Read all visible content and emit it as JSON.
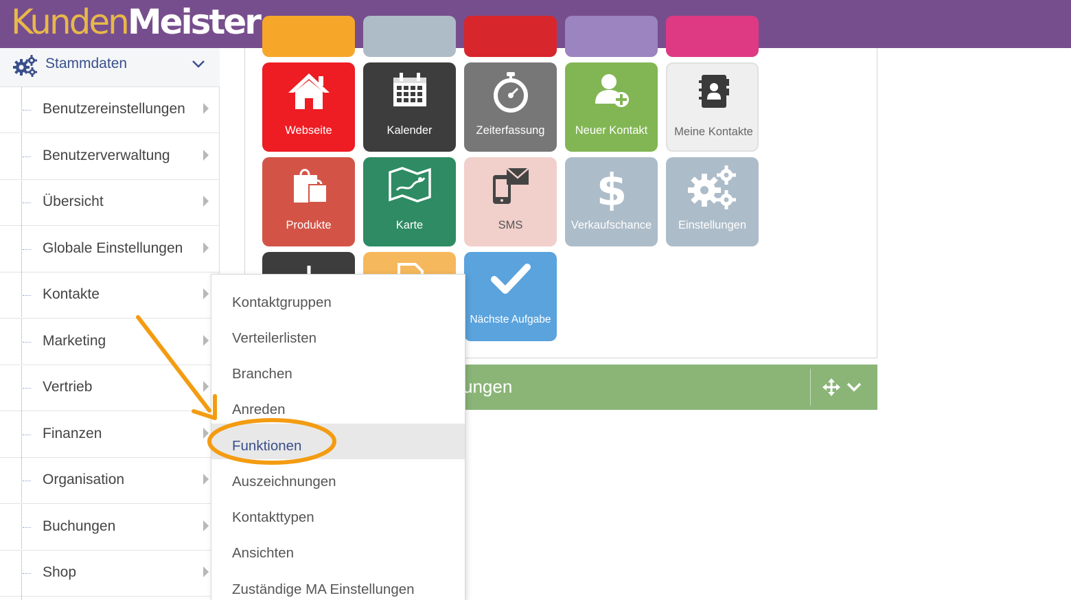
{
  "app": {
    "logo_part1": "Kunden",
    "logo_part2": "Meister",
    "colors": {
      "topbar": "#774e8d",
      "logo_gold": "#e8b84a",
      "accent_blue": "#3a4f8a",
      "highlight_orange": "#f39c12"
    }
  },
  "sidebar": {
    "header_label": "Stammdaten",
    "header_icon": "gears-icon",
    "items": [
      {
        "label": "Benutzereinstellungen"
      },
      {
        "label": "Benutzerverwaltung"
      },
      {
        "label": "Übersicht"
      },
      {
        "label": "Globale Einstellungen"
      },
      {
        "label": "Kontakte"
      },
      {
        "label": "Marketing"
      },
      {
        "label": "Vertrieb"
      },
      {
        "label": "Finanzen"
      },
      {
        "label": "Organisation"
      },
      {
        "label": "Buchungen"
      },
      {
        "label": "Shop"
      }
    ]
  },
  "tiles": [
    {
      "label": "Webseite",
      "icon": "home-icon",
      "color": "#ee1c23"
    },
    {
      "label": "Kalender",
      "icon": "calendar-icon",
      "color": "#3d3d3d"
    },
    {
      "label": "Zeiterfassung",
      "icon": "stopwatch-icon",
      "color": "#777777"
    },
    {
      "label": "Neuer Kontakt",
      "icon": "add-user-icon",
      "color": "#82b654"
    },
    {
      "label": "Meine Kontakte",
      "icon": "address-book-icon",
      "color": "#efefef"
    },
    {
      "label": "Produkte",
      "icon": "shopping-bags-icon",
      "color": "#d35447"
    },
    {
      "label": "Karte",
      "icon": "map-icon",
      "color": "#2e8b63"
    },
    {
      "label": "SMS",
      "icon": "sms-icon",
      "color": "#f1cfcb"
    },
    {
      "label": "Verkaufschance",
      "icon": "dollar-icon",
      "color": "#adbcc9"
    },
    {
      "label": "Einstellungen",
      "icon": "gears-icon",
      "color": "#adbcc9"
    },
    {
      "label": "Nächste Aufgabe",
      "icon": "check-icon",
      "color": "#5aa3dd"
    }
  ],
  "widget_bar": {
    "title_fragment": "ungen"
  },
  "dropdown": {
    "items": [
      {
        "label": "Kontaktgruppen"
      },
      {
        "label": "Verteilerlisten"
      },
      {
        "label": "Branchen"
      },
      {
        "label": "Anreden"
      },
      {
        "label": "Funktionen",
        "active": true
      },
      {
        "label": "Auszeichnungen"
      },
      {
        "label": "Kontakttypen"
      },
      {
        "label": "Ansichten"
      },
      {
        "label": "Zuständige MA Einstellungen"
      }
    ]
  }
}
